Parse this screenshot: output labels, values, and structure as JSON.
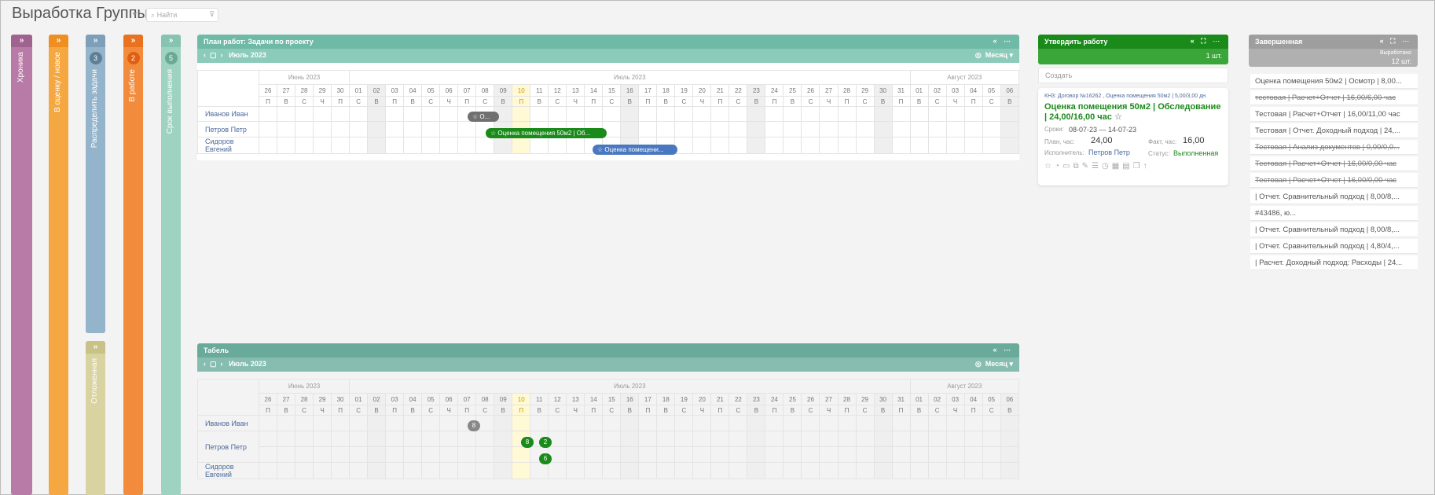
{
  "page": {
    "title": "Выработка Группы",
    "search_placeholder": "Найти"
  },
  "lanes": [
    {
      "label": "Хроника",
      "color": "#b87aa6",
      "badge": ""
    },
    {
      "label": "В оценку / новое",
      "color": "#f5a742",
      "badge": ""
    },
    {
      "label": "Распределить задачи",
      "color": "#94b4cc",
      "badge": "3"
    },
    {
      "label": "В работе",
      "color": "#f28c3c",
      "badge": "2"
    },
    {
      "label": "Срок выполнения",
      "color": "#9ed3c2",
      "badge": "5"
    },
    {
      "label": "Отложенная",
      "color": "#d8d3a0",
      "badge": ""
    }
  ],
  "plan_panel": {
    "title": "План работ: Задачи по проекту",
    "period": "Июль 2023",
    "view": "Месяц",
    "months": [
      "Июнь 2023",
      "Июль 2023",
      "Август 2023"
    ],
    "employees": [
      "Иванов Иван",
      "Петров Петр",
      "Сидоров Евгений"
    ],
    "tasks": [
      {
        "label": "☆ О...",
        "color": "#707070"
      },
      {
        "label": "☆ Оценка помещения 50м2 | Об...",
        "color": "#1a8a1a"
      },
      {
        "label": "☆ Оценка помещени...",
        "color": "#4a78c0"
      }
    ]
  },
  "tabel_panel": {
    "title": "Табель",
    "period": "Июль 2023",
    "view": "Месяц",
    "months": [
      "Июнь 2023",
      "Июль 2023",
      "Август 2023"
    ],
    "employees": [
      "Иванов Иван",
      "Петров Петр",
      "Сидоров Евгений"
    ],
    "hours": [
      {
        "value": "8",
        "color": "#888888"
      },
      {
        "value": "8",
        "color": "#1a8a1a"
      },
      {
        "value": "2",
        "color": "#1a8a1a"
      },
      {
        "value": "6",
        "color": "#1a8a1a"
      }
    ]
  },
  "calendar": {
    "days": [
      "26",
      "27",
      "28",
      "29",
      "30",
      "01",
      "02",
      "03",
      "04",
      "05",
      "06",
      "07",
      "08",
      "09",
      "10",
      "11",
      "12",
      "13",
      "14",
      "15",
      "16",
      "17",
      "18",
      "19",
      "20",
      "21",
      "22",
      "23",
      "24",
      "25",
      "26",
      "27",
      "28",
      "29",
      "30",
      "31",
      "01",
      "02",
      "03",
      "04",
      "05",
      "06"
    ],
    "weekdays": [
      "П",
      "В",
      "С",
      "Ч",
      "П",
      "С",
      "В",
      "П",
      "В",
      "С",
      "Ч",
      "П",
      "С",
      "В",
      "П",
      "В",
      "С",
      "Ч",
      "П",
      "С",
      "В",
      "П",
      "В",
      "С",
      "Ч",
      "П",
      "С",
      "В",
      "П",
      "В",
      "С",
      "Ч",
      "П",
      "С",
      "В",
      "П",
      "В",
      "С",
      "Ч",
      "П",
      "С",
      "В"
    ]
  },
  "approve_panel": {
    "title": "Утвердить работу",
    "count": "1 шт.",
    "create_label": "Создать",
    "card": {
      "contract": "КН3: Договор №16262 , Оценка помещения 50м2 | 5,00/3,00 дн.",
      "title": "Оценка помещения 50м2 | Обследование | 24,00/16,00 час",
      "term_label": "Сроки:",
      "term": "08-07-23 — 14-07-23",
      "plan_label": "План, час:",
      "plan": "24,00",
      "fact_label": "Факт, час:",
      "fact": "16,00",
      "exec_label": "Исполнитель:",
      "exec": "Петров Петр",
      "status_label": "Статус:",
      "status": "Выполненная"
    }
  },
  "done_panel": {
    "title": "Завершенная",
    "summary_label": "Выработано",
    "summary_value": "12 шт.",
    "items": [
      {
        "text": "Оценка помещения 50м2 | Осмотр | 8,00...",
        "strike": false
      },
      {
        "text": "тестовая | Расчет+Отчет | 16,00/6,00 час",
        "strike": true
      },
      {
        "text": "Тестовая | Расчет+Отчет | 16,00/11,00 час",
        "strike": false
      },
      {
        "text": "Тестовая | Отчет. Доходный подход | 24,...",
        "strike": false
      },
      {
        "text": "Тестовая | Анализ документов | 0,00/0,0...",
        "strike": true
      },
      {
        "text": "Тестовая | Расчет+Отчет | 16,00/0,00 час",
        "strike": true
      },
      {
        "text": "Тестовая | Расчет+Отчет | 16,00/0,00 час",
        "strike": true
      },
      {
        "text": "| Отчет. Сравнительный подход | 8,00/8,...",
        "strike": false
      },
      {
        "text": "#43486,                                         ю...",
        "strike": false
      },
      {
        "text": "| Отчет. Сравнительный подход | 8,00/8,...",
        "strike": false
      },
      {
        "text": "| Отчет. Сравнительный подход | 4,80/4,...",
        "strike": false
      },
      {
        "text": "| Расчет. Доходный подход: Расходы | 24...",
        "strike": false
      }
    ]
  },
  "colors": {
    "plan_header": "#6fb9a7",
    "plan_sub": "#8ccbb9",
    "tabel_header": "#6aaa9a",
    "tabel_sub": "#86bdb0",
    "approve": "#1a8a1a",
    "done": "#9e9e9e"
  }
}
